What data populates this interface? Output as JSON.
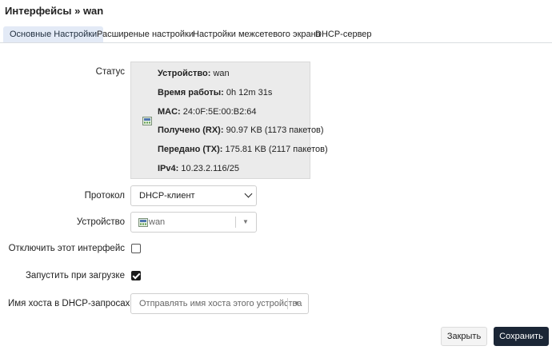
{
  "page": {
    "title": "Интерфейсы » wan"
  },
  "tabs": [
    {
      "label": "Основные Настройки",
      "active": true
    },
    {
      "label": "Расширеные настройки",
      "active": false
    },
    {
      "label": "Настройки межсетевого экрана",
      "active": false
    },
    {
      "label": "DHCP-сервер",
      "active": false
    }
  ],
  "status": {
    "label": "Статус",
    "icon": "network-port-icon",
    "lines": [
      {
        "key": "Устройство:",
        "value": "wan"
      },
      {
        "key": "Время работы:",
        "value": "0h 12m 31s"
      },
      {
        "key": "MAC:",
        "value": "24:0F:5E:00:B2:64"
      },
      {
        "key": "Получено (RX):",
        "value": "90.97 KB (1173 пакетов)"
      },
      {
        "key": "Передано (TX):",
        "value": "175.81 KB (2117 пакетов)"
      },
      {
        "key": "IPv4:",
        "value": "10.23.2.116/25"
      }
    ]
  },
  "form": {
    "protocol": {
      "label": "Протокол",
      "value": "DHCP-клиент"
    },
    "device": {
      "label": "Устройство",
      "value": "wan",
      "icon": "network-port-icon"
    },
    "disable": {
      "label": "Отключить этот интерфейс",
      "checked": false
    },
    "autostart": {
      "label": "Запустить при загрузке",
      "checked": true
    },
    "hostname": {
      "label": "Имя хоста в DHCP-запросах",
      "placeholder": "Отправлять имя хоста этого устройства"
    }
  },
  "buttons": {
    "close": "Закрыть",
    "save": "Сохранить"
  },
  "colors": {
    "active_tab": "#e3eaf6",
    "status_bg": "#ebebeb",
    "save_button": "#1b2636"
  }
}
